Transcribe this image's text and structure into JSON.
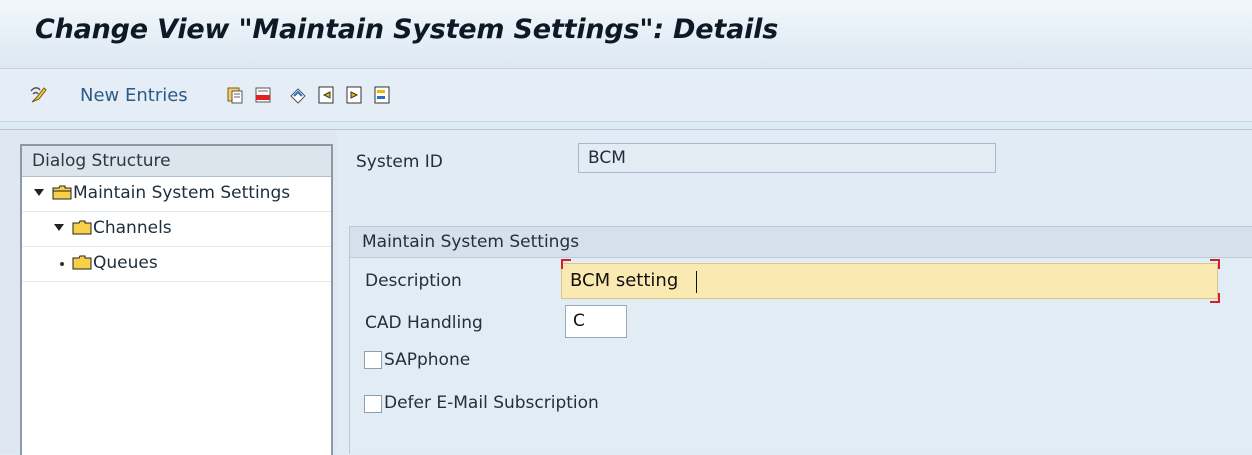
{
  "window": {
    "title": "Change View \"Maintain System Settings\": Details"
  },
  "toolbar": {
    "new_entries_label": "New Entries",
    "icons": [
      "display-change-icon",
      "copy-icon",
      "delete-icon",
      "undo-change-icon",
      "previous-entry-icon",
      "next-entry-icon",
      "select-block-icon"
    ]
  },
  "dialog_structure": {
    "header": "Dialog Structure",
    "items": [
      {
        "label": "Maintain System Settings",
        "level": 0,
        "expanded": true,
        "selected": true
      },
      {
        "label": "Channels",
        "level": 1,
        "expanded": true
      },
      {
        "label": "Queues",
        "level": 2,
        "expanded": false
      }
    ]
  },
  "main": {
    "system_id": {
      "label": "System ID",
      "value": "BCM"
    },
    "group": {
      "title": "Maintain System Settings",
      "description": {
        "label": "Description",
        "value": "BCM setting"
      },
      "cad_handling": {
        "label": "CAD Handling",
        "value": "C"
      },
      "sapphone": {
        "label": "SAPphone",
        "checked": false
      },
      "defer_email": {
        "label": "Defer E-Mail Subscription",
        "checked": false
      }
    }
  },
  "colors": {
    "title_bg": "#e9f1f8",
    "accent": "#2d5b88",
    "active_input_bg": "#faeab1",
    "required_marker": "#d61f2c"
  }
}
